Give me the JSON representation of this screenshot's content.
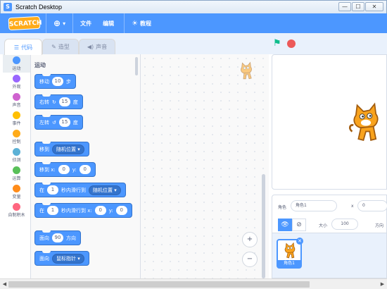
{
  "window": {
    "title": "Scratch Desktop",
    "minimize": "—",
    "maximize": "☐",
    "close": "✕"
  },
  "menubar": {
    "logo": "SCRATCH",
    "file": "文件",
    "edit": "编辑",
    "tutorials": "教程",
    "language_icon": "globe-icon"
  },
  "tabs": {
    "code": "代码",
    "costumes": "造型",
    "sounds": "声音"
  },
  "categories": [
    {
      "label": "运动",
      "color": "#4c97ff"
    },
    {
      "label": "外观",
      "color": "#9966ff"
    },
    {
      "label": "声音",
      "color": "#cf63cf"
    },
    {
      "label": "事件",
      "color": "#ffbf00"
    },
    {
      "label": "控制",
      "color": "#ffab19"
    },
    {
      "label": "侦测",
      "color": "#5cb1d6"
    },
    {
      "label": "运算",
      "color": "#59c059"
    },
    {
      "label": "变量",
      "color": "#ff8c1a"
    },
    {
      "label": "自制积木",
      "color": "#ff6680"
    }
  ],
  "palette": {
    "heading": "运动",
    "move": {
      "pre": "移动",
      "value": "10",
      "post": "步"
    },
    "turn_right": {
      "pre": "右转",
      "icon": "↻",
      "value": "15",
      "post": "度"
    },
    "turn_left": {
      "pre": "左转",
      "icon": "↺",
      "value": "15",
      "post": "度"
    },
    "goto": {
      "pre": "移到",
      "dropdown": "随机位置 ▾"
    },
    "goto_xy": {
      "pre": "移到 x:",
      "x": "0",
      "mid": "y:",
      "y": "0"
    },
    "glide": {
      "pre": "在",
      "value": "1",
      "mid": "秒内滑行到",
      "dropdown": "随机位置 ▾"
    },
    "glide_xy": {
      "pre": "在",
      "value": "1",
      "mid": "秒内滑行到 x:",
      "x": "0",
      "mid2": "y:",
      "y": "0"
    },
    "point": {
      "pre": "面向",
      "value": "90",
      "post": "方向"
    },
    "point_towards": {
      "pre": "面向",
      "dropdown": "鼠标指针 ▾"
    }
  },
  "zoom": {
    "in": "+",
    "out": "−"
  },
  "sprite_info": {
    "sprite_label": "角色",
    "sprite_name": "角色1",
    "x_label": "x",
    "x_value": "0",
    "size_label": "大小",
    "size_value": "100",
    "direction_label": "方向",
    "show_icon": "👁",
    "hide_icon": "⊘"
  },
  "sprite_list": {
    "tile_name": "角色1",
    "delete": "✕"
  },
  "colors": {
    "accent": "#4c97ff",
    "flag": "#0fbd8c",
    "stop": "#ec5959"
  }
}
